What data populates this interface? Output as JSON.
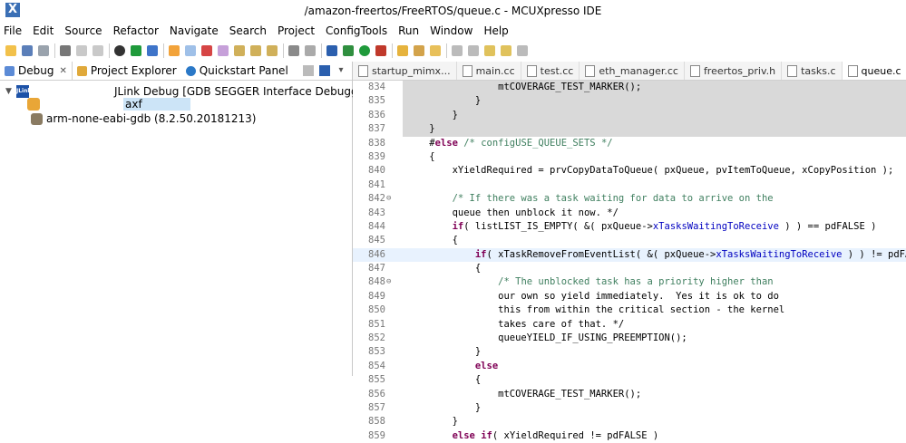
{
  "window": {
    "title": "/amazon-freertos/FreeRTOS/queue.c - MCUXpresso IDE"
  },
  "menu": [
    "File",
    "Edit",
    "Source",
    "Refactor",
    "Navigate",
    "Search",
    "Project",
    "ConfigTools",
    "Run",
    "Window",
    "Help"
  ],
  "left_tabs": [
    {
      "label": "Debug",
      "icon": "debug-icon"
    },
    {
      "label": "Project Explorer",
      "icon": "project-explorer-icon"
    },
    {
      "label": "Quickstart Panel",
      "icon": "quickstart-icon"
    }
  ],
  "tree": {
    "launch_config": "JLink Debug [GDB SEGGER Interface Debugging]",
    "process": "axf",
    "gdb": "arm-none-eabi-gdb (8.2.50.20181213)"
  },
  "editor_tabs": [
    "startup_mimx...",
    "main.cc",
    "test.cc",
    "eth_manager.cc",
    "freertos_priv.h",
    "tasks.c",
    "queue.c"
  ],
  "code_lines": [
    {
      "n": "834",
      "text": "                mtCOVERAGE_TEST_MARKER();",
      "bg": "gray"
    },
    {
      "n": "835",
      "text": "            }",
      "bg": "gray"
    },
    {
      "n": "836",
      "text": "        }",
      "bg": "gray"
    },
    {
      "n": "837",
      "text": "    }",
      "bg": "gray"
    },
    {
      "n": "838",
      "text": "    #else /* configUSE_QUEUE_SETS */"
    },
    {
      "n": "839",
      "text": "    {"
    },
    {
      "n": "840",
      "text": "        xYieldRequired = prvCopyDataToQueue( pxQueue, pvItemToQueue, xCopyPosition );"
    },
    {
      "n": "841",
      "text": ""
    },
    {
      "n": "842",
      "fold": "⊖",
      "text": "        /* If there was a task waiting for data to arrive on the"
    },
    {
      "n": "843",
      "text": "        queue then unblock it now. */"
    },
    {
      "n": "844",
      "text": "        if( listLIST_IS_EMPTY( &( pxQueue->xTasksWaitingToReceive ) ) == pdFALSE )"
    },
    {
      "n": "845",
      "text": "        {"
    },
    {
      "n": "846",
      "text": "            if( xTaskRemoveFromEventList( &( pxQueue->xTasksWaitingToReceive ) ) != pdFALSE )",
      "bg": "cur"
    },
    {
      "n": "847",
      "text": "            {"
    },
    {
      "n": "848",
      "fold": "⊖",
      "text": "                /* The unblocked task has a priority higher than"
    },
    {
      "n": "849",
      "text": "                our own so yield immediately.  Yes it is ok to do"
    },
    {
      "n": "850",
      "text": "                this from within the critical section - the kernel"
    },
    {
      "n": "851",
      "text": "                takes care of that. */"
    },
    {
      "n": "852",
      "text": "                queueYIELD_IF_USING_PREEMPTION();"
    },
    {
      "n": "853",
      "text": "            }"
    },
    {
      "n": "854",
      "text": "            else"
    },
    {
      "n": "855",
      "text": "            {"
    },
    {
      "n": "856",
      "text": "                mtCOVERAGE_TEST_MARKER();"
    },
    {
      "n": "857",
      "text": "            }"
    },
    {
      "n": "858",
      "text": "        }"
    },
    {
      "n": "859",
      "text": "        else if( xYieldRequired != pdFALSE )"
    }
  ],
  "colors": {
    "selection": "#cce4f7",
    "gray_block": "#d9d9d9",
    "current_line": "#e8f2fe",
    "keyword": "#7f0055",
    "comment": "#3f7f5f"
  }
}
